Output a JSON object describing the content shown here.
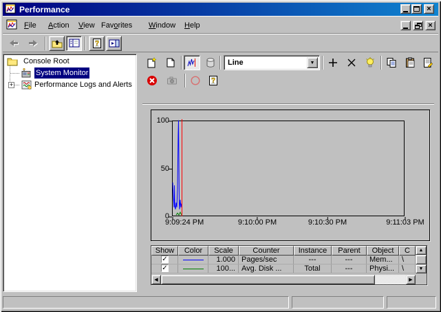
{
  "window": {
    "title": "Performance"
  },
  "menu": {
    "items": [
      {
        "pre": "",
        "key": "F",
        "post": "ile"
      },
      {
        "pre": "",
        "key": "A",
        "post": "ction"
      },
      {
        "pre": "",
        "key": "V",
        "post": "iew"
      },
      {
        "pre": "Fav",
        "key": "o",
        "post": "rites"
      },
      {
        "pre": "",
        "key": "W",
        "post": "indow"
      },
      {
        "pre": "",
        "key": "H",
        "post": "elp"
      }
    ]
  },
  "tree": {
    "root_label": "Console Root",
    "items": [
      {
        "label": "System Monitor",
        "selected": true
      },
      {
        "label": "Performance Logs and Alerts",
        "expandable": true
      }
    ]
  },
  "graph_toolbar": {
    "graph_type": "Line"
  },
  "chart_data": {
    "type": "line",
    "title": "",
    "ylim": [
      0,
      100
    ],
    "yticks": [
      100,
      50,
      0
    ],
    "x_total_seconds": 99,
    "xticks": [
      {
        "seconds": 0,
        "label": "9:09:24 PM"
      },
      {
        "seconds": 36,
        "label": "9:10:00 PM"
      },
      {
        "seconds": 66,
        "label": "9:10:30 PM"
      },
      {
        "seconds": 99,
        "label": "9:11:03 PM"
      }
    ],
    "grid": false,
    "legend_position": "bottom-table",
    "time_marker_seconds": 3.95,
    "time_marker_color": "#ff0000",
    "series": [
      {
        "name": "Pages/sec",
        "color": "#0000ff",
        "x_seconds": [
          0,
          0.29,
          0.59,
          0.73,
          0.88,
          1.17,
          1.46,
          1.76,
          2.05,
          2.34,
          2.49,
          2.64,
          2.78,
          2.93,
          3.22,
          3.52,
          3.81
        ],
        "values": [
          36,
          20,
          10,
          33,
          12,
          8,
          15,
          10,
          30,
          86,
          101,
          60,
          15,
          8,
          18,
          10,
          14
        ]
      },
      {
        "name": "Avg. Disk ...",
        "color": "#008000",
        "x_seconds": [
          1.46,
          2.05,
          2.64,
          3.22,
          3.81
        ],
        "values": [
          2,
          4,
          2,
          5,
          2
        ]
      }
    ]
  },
  "legend": {
    "columns": [
      "Show",
      "Color",
      "Scale",
      "Counter",
      "Instance",
      "Parent",
      "Object",
      "C"
    ],
    "rows": [
      {
        "show": "✓",
        "color": "#0000ff",
        "scale": "1.000",
        "counter": "Pages/sec",
        "instance": "---",
        "parent": "---",
        "object": "Mem...",
        "computer": "\\"
      },
      {
        "show": "✓",
        "color": "#008000",
        "scale": "100...",
        "counter": "Avg. Disk ...",
        "instance": "Total",
        "parent": "---",
        "object": "Physi...",
        "computer": "\\"
      }
    ]
  },
  "icons": {
    "up_arrow": "▲",
    "down_arrow": "▼",
    "left_arrow": "◀",
    "right_arrow": "▶",
    "combo_arrow": "▼",
    "check": "✓",
    "close_glyph": "×",
    "plus_glyph": "+"
  },
  "colors": {
    "titlebar_left": "#000080",
    "titlebar_right": "#1084d0",
    "selection": "#000080",
    "window_face": "#c0c0c0",
    "series1": "#0000ff",
    "series2": "#008000",
    "time_marker": "#ff0000"
  }
}
